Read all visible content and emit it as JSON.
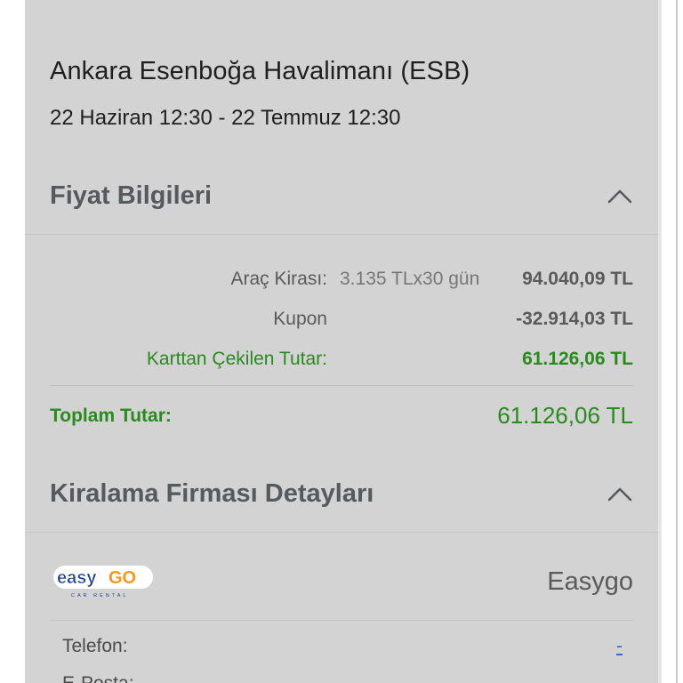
{
  "booking": {
    "location": "Ankara Esenboğa Havalimanı (ESB)",
    "dates": "22 Haziran 12:30 - 22 Temmuz 12:30"
  },
  "price_section": {
    "title": "Fiyat Bilgileri",
    "rows": [
      {
        "label": "Araç Kirası:",
        "calc": "3.135 TLx30 gün",
        "amount": "94.040,09 TL"
      },
      {
        "label": "Kupon",
        "calc": "",
        "amount": "-32.914,03 TL"
      },
      {
        "label": "Karttan Çekilen Tutar:",
        "calc": "",
        "amount": "61.126,06 TL"
      }
    ],
    "total_label": "Toplam Tutar:",
    "total_amount": "61.126,06 TL"
  },
  "company_section": {
    "title": "Kiralama Firması Detayları",
    "logo_text": "easyGO",
    "logo_subtext": "CAR RENTAL",
    "name": "Easygo",
    "details": [
      {
        "label": "Telefon:",
        "value": "-"
      },
      {
        "label": "E-Posta:",
        "value": ""
      }
    ]
  },
  "colors": {
    "green": "#2a8a1f",
    "page_bg": "#d3d3d3",
    "logo_blue": "#1d3f8f",
    "logo_orange": "#f29a1f"
  }
}
